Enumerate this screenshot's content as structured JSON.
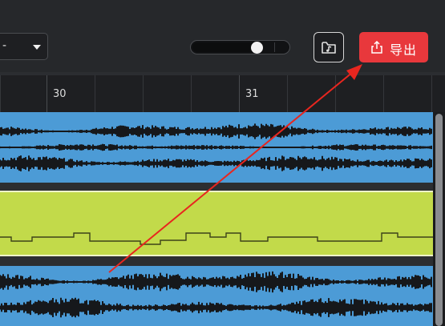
{
  "toolbar": {
    "dropdown_value": "-",
    "export_label": "导出",
    "zoom_level": 0.73
  },
  "ruler": {
    "marks": [
      "30",
      "31"
    ]
  },
  "colors": {
    "accent_red": "#e8383c",
    "waveform_blue": "#4c9bd6",
    "lyric_track_green": "#c2da4a"
  },
  "icons": {
    "folder_button": "music-folder-icon",
    "export_button": "share-upload-icon",
    "dropdown": "caret-down-icon"
  }
}
